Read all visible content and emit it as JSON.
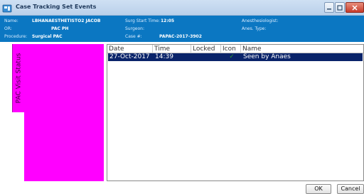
{
  "window": {
    "title": "Case Tracking Set Events"
  },
  "header": {
    "name_label": "Name:",
    "name_value": "LBHANAESTHETISTO2 JACOB",
    "or_label": "OR:",
    "or_value": "PAC PH",
    "procedure_label": "Procedure:",
    "procedure_value": "Surgical PAC",
    "surg_start_label": "Surg Start Time:",
    "surg_start_value": "12:05",
    "surgeon_label": "Surgeon:",
    "surgeon_value": "",
    "case_label": "Case #:",
    "case_value": "PAPAC-2017-3902",
    "anesthesiologist_label": "Anesthesiologist:",
    "anesthesiologist_value": "",
    "anes_type_label": "Anes. Type:",
    "anes_type_value": ""
  },
  "status_tab": {
    "label": "PAC Visit Status"
  },
  "grid": {
    "columns": [
      "Date",
      "Time",
      "Locked",
      "Icon",
      "Name"
    ],
    "rows": [
      {
        "date": "27-Oct-2017",
        "time": "14:39",
        "locked": "",
        "icon": "✓",
        "name": "Seen by Anaes",
        "selected": true
      }
    ]
  },
  "buttons": {
    "ok": "OK",
    "cancel": "Cancel"
  },
  "colors": {
    "header_band": "#0b77c2",
    "status_panel": "#ff00ff",
    "selected_row": "#0a246a",
    "checkmark": "#2e9b2e"
  },
  "icons": {
    "app": "case-tracking-app-icon",
    "minimize": "minimize-icon",
    "maximize": "maximize-icon",
    "close": "close-icon",
    "check": "checkmark-icon"
  }
}
